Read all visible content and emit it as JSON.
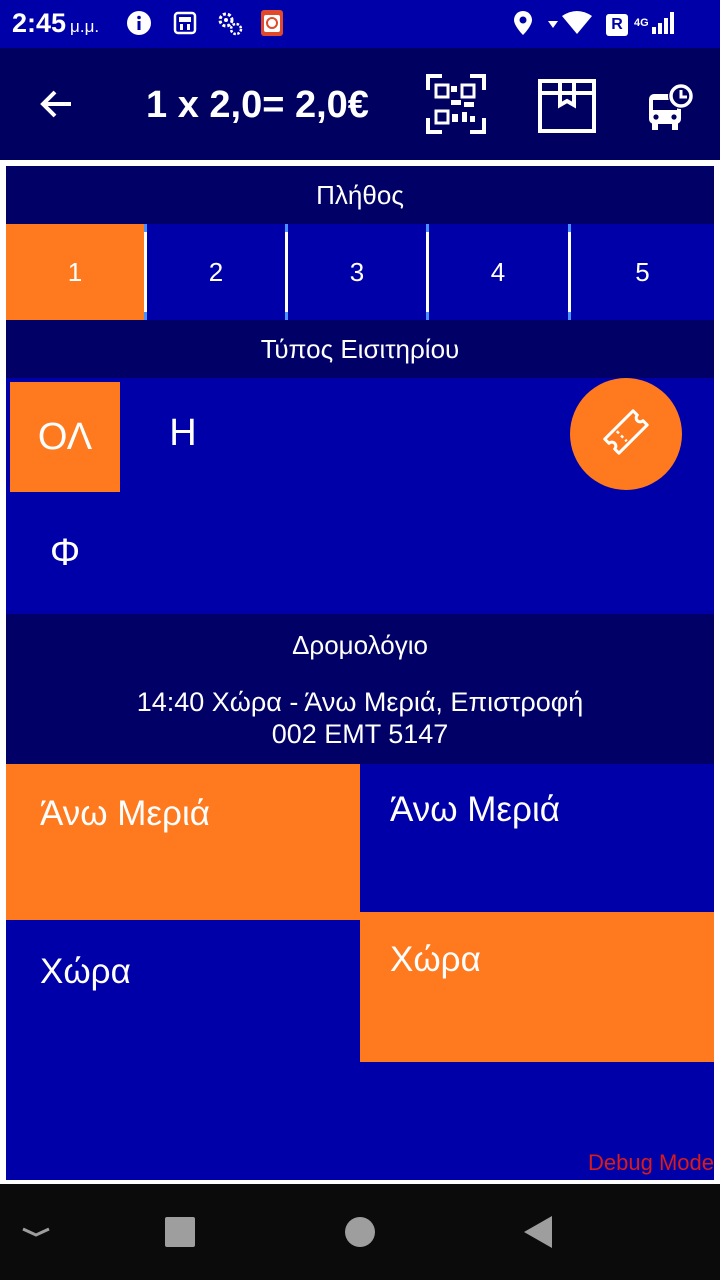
{
  "status_bar": {
    "time": "2:45",
    "period": "μ.μ.",
    "icons": [
      "info-icon",
      "store-icon",
      "settings-gears-icon",
      "app-notification-icon",
      "location-icon",
      "wifi-icon",
      "roaming-icon",
      "signal-4g-icon"
    ],
    "roaming_label": "R",
    "network_label": "4G"
  },
  "app_bar": {
    "title": "1 x 2,0= 2,0€",
    "back_icon": "arrow-back-icon",
    "actions": [
      "qr-scan-icon",
      "package-icon",
      "bus-schedule-icon"
    ]
  },
  "quantity": {
    "label": "Πλήθος",
    "options": [
      "1",
      "2",
      "3",
      "4",
      "5"
    ],
    "selected": "1"
  },
  "ticket_type": {
    "label": "Τύπος Εισιτηρίου",
    "options": [
      "ΟΛ",
      "Η",
      "Φ"
    ],
    "selected": "ΟΛ",
    "fab_icon": "ticket-icon"
  },
  "route": {
    "label": "Δρομολόγιο",
    "line1": "14:40 Χώρα - Άνω Μεριά, Επιστροφή",
    "line2": "002 ΕΜΤ 5147"
  },
  "stops": {
    "from": [
      "Άνω Μεριά",
      "Χώρα"
    ],
    "to": [
      "Άνω Μεριά",
      "Χώρα"
    ],
    "selected_from": "Άνω Μεριά",
    "selected_to": "Χώρα"
  },
  "debug_label": "Debug Mode",
  "colors": {
    "primary": "#0000a8",
    "dark": "#000066",
    "accent": "#ff7a1e",
    "debug": "#d81b1b"
  }
}
